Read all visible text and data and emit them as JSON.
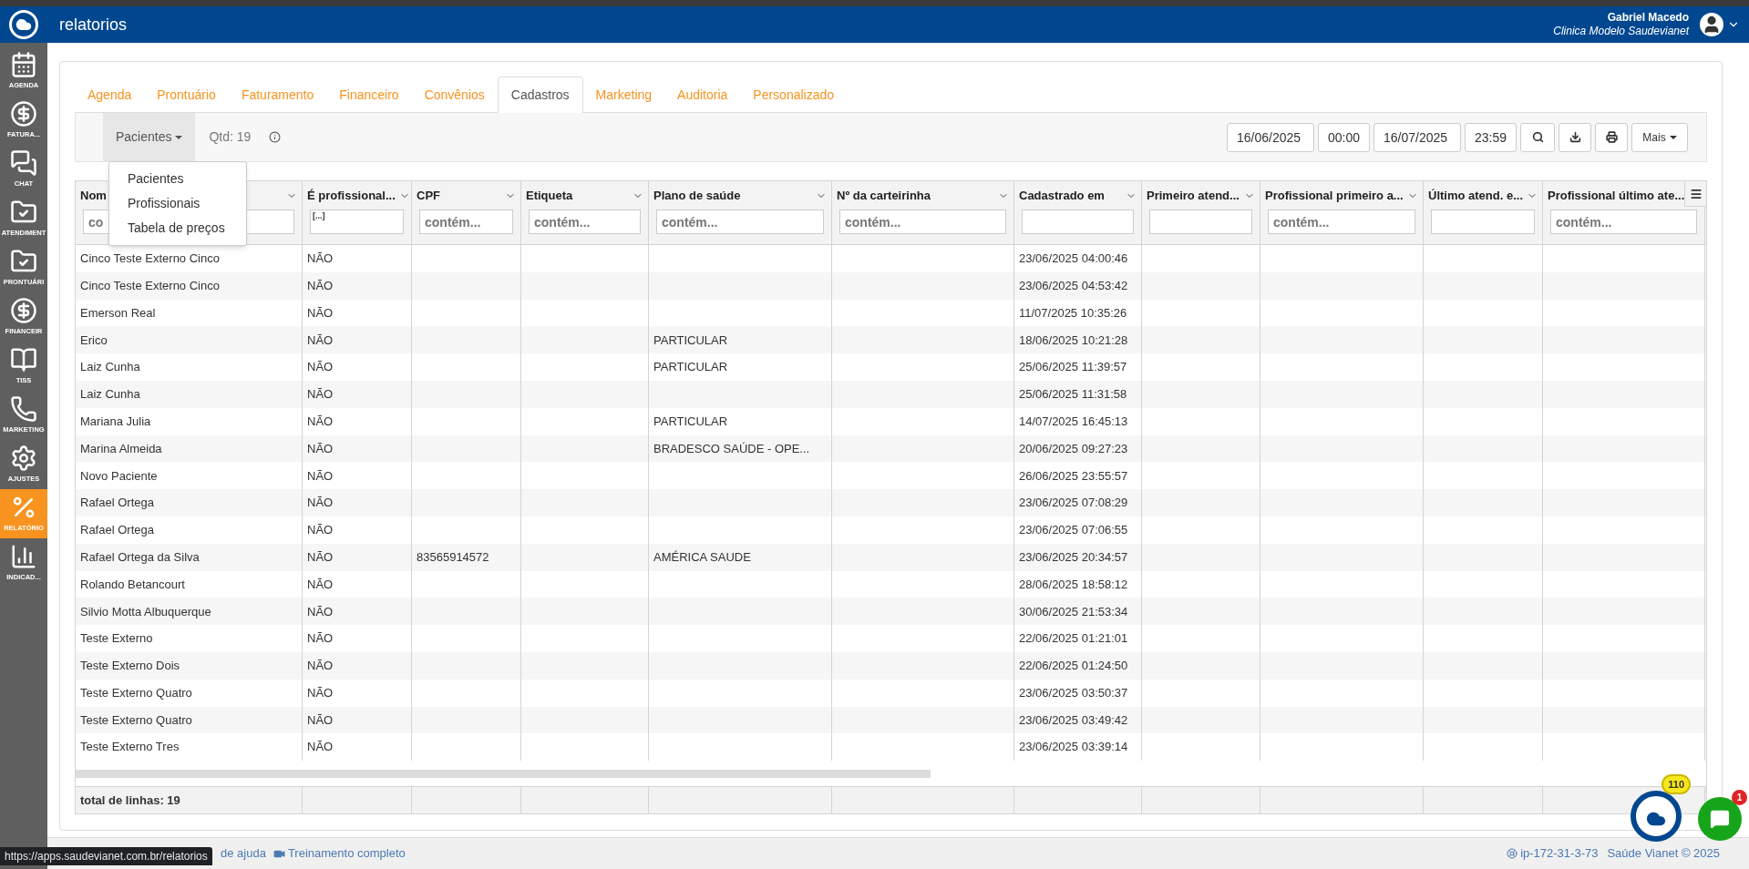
{
  "header": {
    "title": "relatorios",
    "user_name": "Gabriel Macedo",
    "clinic": "Clinica Modelo Saudevianet"
  },
  "sidebar": {
    "items": [
      {
        "kind": "calendar",
        "label": "AGENDA",
        "selected": false
      },
      {
        "kind": "invoice",
        "label": "FATURA...",
        "selected": false
      },
      {
        "kind": "chat",
        "label": "CHAT",
        "selected": false
      },
      {
        "kind": "folder",
        "label": "ATENDIMENT",
        "selected": false
      },
      {
        "kind": "folder",
        "label": "PRONTUÁRI",
        "selected": false
      },
      {
        "kind": "invoice",
        "label": "FINANCEIR",
        "selected": false
      },
      {
        "kind": "book",
        "label": "TISS",
        "selected": false
      },
      {
        "kind": "phone",
        "label": "MARKETING",
        "selected": false
      },
      {
        "kind": "gears",
        "label": "AJUSTES",
        "selected": false
      },
      {
        "kind": "percent",
        "label": "RELATÓRIO",
        "selected": true
      },
      {
        "kind": "bars",
        "label": "INDICAD...",
        "selected": false
      }
    ]
  },
  "tabs": [
    {
      "label": "Agenda",
      "selected": false
    },
    {
      "label": "Prontuário",
      "selected": false
    },
    {
      "label": "Faturamento",
      "selected": false
    },
    {
      "label": "Financeiro",
      "selected": false
    },
    {
      "label": "Convênios",
      "selected": false
    },
    {
      "label": "Cadastros",
      "selected": true
    },
    {
      "label": "Marketing",
      "selected": false
    },
    {
      "label": "Auditoria",
      "selected": false
    },
    {
      "label": "Personalizado",
      "selected": false
    }
  ],
  "toolbar": {
    "report_type": "Pacientes",
    "count": "Qtd: 19",
    "start_date": "16/06/2025",
    "start_time": "00:00",
    "end_date": "16/07/2025",
    "end_time": "23:59",
    "more_button": "Mais"
  },
  "report_menu": {
    "expanded": true,
    "items": [
      "Pacientes",
      "Profissionais",
      "Tabela de preços"
    ]
  },
  "table": {
    "columns": [
      {
        "label": "Nom",
        "filter": {
          "kind": "text",
          "placeholder": "co"
        }
      },
      {
        "label": "É profissional...",
        "filter": {
          "kind": "select",
          "value": "[...]"
        }
      },
      {
        "label": "CPF",
        "filter": {
          "kind": "text",
          "placeholder": "contém..."
        }
      },
      {
        "label": "Etiqueta",
        "filter": {
          "kind": "text",
          "placeholder": "contém..."
        }
      },
      {
        "label": "Plano de saúde",
        "filter": {
          "kind": "text",
          "placeholder": "contém..."
        }
      },
      {
        "label": "Nº da carteirinha",
        "filter": {
          "kind": "text",
          "placeholder": "contém..."
        }
      },
      {
        "label": "Cadastrado em",
        "filter": {
          "kind": "date"
        }
      },
      {
        "label": "Primeiro atend...",
        "filter": {
          "kind": "date"
        }
      },
      {
        "label": "Profissional primeiro a...",
        "filter": {
          "kind": "text",
          "placeholder": "contém..."
        }
      },
      {
        "label": "Último atend. e...",
        "filter": {
          "kind": "date"
        }
      },
      {
        "label": "Profissional último ate...",
        "filter": {
          "kind": "text",
          "placeholder": "contém..."
        }
      }
    ],
    "rows": [
      {
        "name": "Cinco Teste Externo Cinco",
        "professional": "NÃO",
        "registered_at": "23/06/2025 04:00:46"
      },
      {
        "name": "Cinco Teste Externo Cinco",
        "professional": "NÃO",
        "registered_at": "23/06/2025 04:53:42"
      },
      {
        "name": "Emerson Real",
        "professional": "NÃO",
        "registered_at": "11/07/2025 10:35:26"
      },
      {
        "name": "Erico",
        "professional": "NÃO",
        "plan": "PARTICULAR",
        "registered_at": "18/06/2025 10:21:28"
      },
      {
        "name": "Laiz Cunha",
        "professional": "NÃO",
        "plan": "PARTICULAR",
        "registered_at": "25/06/2025 11:39:57"
      },
      {
        "name": "Laiz Cunha",
        "professional": "NÃO",
        "registered_at": "25/06/2025 11:31:58"
      },
      {
        "name": "Mariana Julia",
        "professional": "NÃO",
        "plan": "PARTICULAR",
        "registered_at": "14/07/2025 16:45:13"
      },
      {
        "name": "Marina Almeida",
        "professional": "NÃO",
        "plan": "BRADESCO SAÚDE - OPE...",
        "registered_at": "20/06/2025 09:27:23"
      },
      {
        "name": "Novo Paciente",
        "professional": "NÃO",
        "registered_at": "26/06/2025 23:55:57"
      },
      {
        "name": "Rafael Ortega",
        "professional": "NÃO",
        "registered_at": "23/06/2025 07:08:29"
      },
      {
        "name": "Rafael Ortega",
        "professional": "NÃO",
        "registered_at": "23/06/2025 07:06:55"
      },
      {
        "name": "Rafael Ortega da Silva",
        "professional": "NÃO",
        "cpf": "83565914572",
        "plan": "AMÉRICA SAUDE",
        "registered_at": "23/06/2025 20:34:57"
      },
      {
        "name": "Rolando Betancourt",
        "professional": "NÃO",
        "registered_at": "28/06/2025 18:58:12"
      },
      {
        "name": "Silvio Motta Albuquerque",
        "professional": "NÃO",
        "registered_at": "30/06/2025 21:53:34"
      },
      {
        "name": "Teste Externo",
        "professional": "NÃO",
        "registered_at": "22/06/2025 01:21:01"
      },
      {
        "name": "Teste Externo Dois",
        "professional": "NÃO",
        "registered_at": "22/06/2025 01:24:50"
      },
      {
        "name": "Teste Externo Quatro",
        "professional": "NÃO",
        "registered_at": "23/06/2025 03:50:37"
      },
      {
        "name": "Teste Externo Quatro",
        "professional": "NÃO",
        "registered_at": "23/06/2025 03:49:42"
      },
      {
        "name": "Teste Externo Tres",
        "professional": "NÃO",
        "registered_at": "23/06/2025 03:39:14"
      }
    ],
    "total": "total de linhas: 19"
  },
  "footer": {
    "tooltip_url": "https://apps.saudevianet.com.br/relatorios",
    "help_link": "de ajuda",
    "training_link": "Treinamento completo",
    "server": "ip-172-31-3-73",
    "copyright": "Saúde Vianet © 2025"
  },
  "widgets": {
    "chat_badge": "110",
    "messages_badge": "1"
  }
}
